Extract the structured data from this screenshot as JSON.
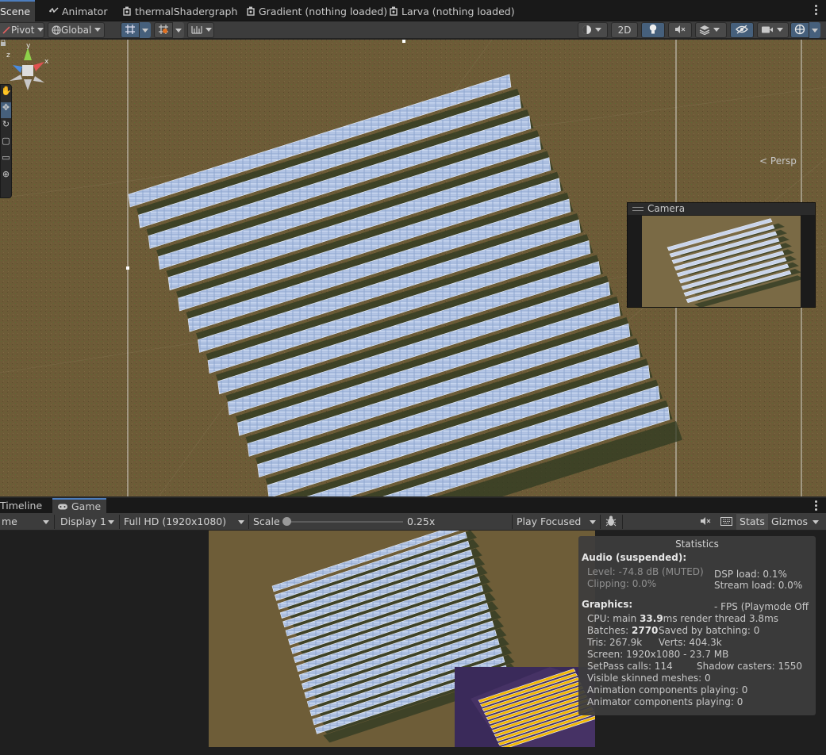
{
  "tabs": [
    {
      "label": "Scene",
      "icon": "scene-icon"
    },
    {
      "label": "Animator",
      "icon": "animator-icon"
    },
    {
      "label": "thermalShadergraph",
      "icon": "shadergraph-icon"
    },
    {
      "label": "Gradient (nothing loaded)",
      "icon": "shadergraph-icon"
    },
    {
      "label": "Larva (nothing loaded)",
      "icon": "shadergraph-icon"
    }
  ],
  "scene_toolbar": {
    "pivot_label": "Pivot",
    "global_label": "Global",
    "mode_2d_label": "2D"
  },
  "scene_view": {
    "persp_label": "Persp",
    "axis_x": "x",
    "axis_y": "y",
    "axis_z": "z"
  },
  "camera_preview": {
    "title": "Camera"
  },
  "game_tabs": [
    {
      "label": "Timeline"
    },
    {
      "label": "Game"
    }
  ],
  "game_toolbar": {
    "mode_label": "me",
    "display_label": "Display 1",
    "resolution_label": "Full HD (1920x1080)",
    "scale_label": "Scale",
    "scale_value": "0.25x",
    "scale_fraction": 0.0,
    "play_mode_label": "Play Focused",
    "stats_label": "Stats",
    "gizmos_label": "Gizmos"
  },
  "stats": {
    "title": "Statistics",
    "audio_header": "Audio (suspended):",
    "level": "Level: -74.8 dB (MUTED)",
    "clipping": "Clipping: 0.0%",
    "dsp_load": "DSP load: 0.1%",
    "stream_load": "Stream load: 0.0%",
    "graphics_header": "Graphics:",
    "fps": "- FPS (Playmode Off",
    "cpu_prefix": "CPU: main ",
    "cpu_main": "33.9",
    "cpu_suffix": "ms  render thread 3.8ms",
    "batches_prefix": "Batches: ",
    "batches_value": "2770",
    "saved_by_batching": "Saved by batching: 0",
    "tris": "Tris: 267.9k",
    "verts": "Verts: 404.3k",
    "screen": "Screen: 1920x1080 - 23.7 MB",
    "setpass": "SetPass calls: 114",
    "shadow_casters": "Shadow casters: 1550",
    "skinned": "Visible skinned meshes: 0",
    "animation": "Animation components playing: 0",
    "animator": "Animator components playing: 0"
  },
  "colors": {
    "accent": "#4c7dbe",
    "ground": "#6b5a37",
    "panel": "#3c3c3c",
    "panel_dark": "#191919",
    "thermal_hot": "#f2b705",
    "thermal_bg": "#2a1f4a"
  }
}
